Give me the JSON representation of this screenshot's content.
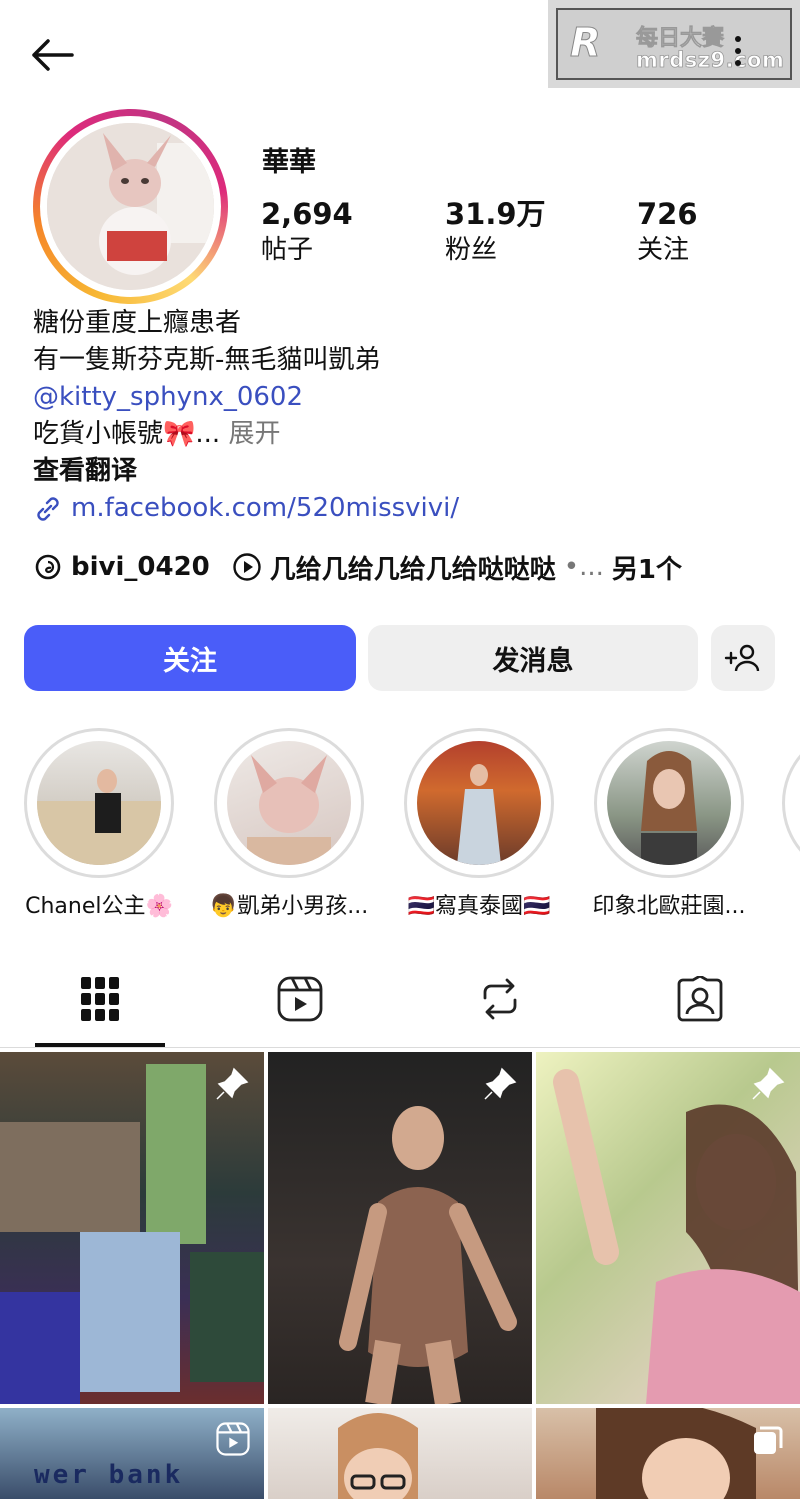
{
  "header": {
    "back_icon": "arrow-left-icon",
    "more_icon": "kebab-menu-icon"
  },
  "watermark": {
    "logo": "R",
    "cn": "每日大賽",
    "url": "mrdsz9.com"
  },
  "profile": {
    "name": "華華",
    "stats": [
      {
        "value": "2,694",
        "label": "帖子"
      },
      {
        "value": "31.9万",
        "label": "粉丝"
      },
      {
        "value": "726",
        "label": "关注"
      }
    ]
  },
  "bio": {
    "line1": "糖份重度上癮患者",
    "line2": "有一隻斯芬克斯-無毛貓叫凱弟",
    "threads_handle": "@kitty_sphynx_0602",
    "line4": "吃貨小帳號🎀...",
    "expand": "展开",
    "translate": "查看翻译",
    "link": "m.facebook.com/520missvivi/"
  },
  "threads_row": {
    "handle": "bivi_0420",
    "audio": "几给几给几给几给哒哒哒",
    "dot": "•...",
    "more": "另1个"
  },
  "actions": {
    "follow": "关注",
    "message": "发消息"
  },
  "highlights": [
    {
      "label": "Chanel公主🌸"
    },
    {
      "label": "👦凱弟小男孩..."
    },
    {
      "label": "🇹🇭寫真泰國🇹🇭"
    },
    {
      "label": "印象北歐莊園..."
    }
  ],
  "tabs": [
    {
      "icon": "grid-icon"
    },
    {
      "icon": "reels-icon"
    },
    {
      "icon": "reposts-icon"
    },
    {
      "icon": "tagged-icon"
    }
  ],
  "grid_bank_text": "wer bank"
}
